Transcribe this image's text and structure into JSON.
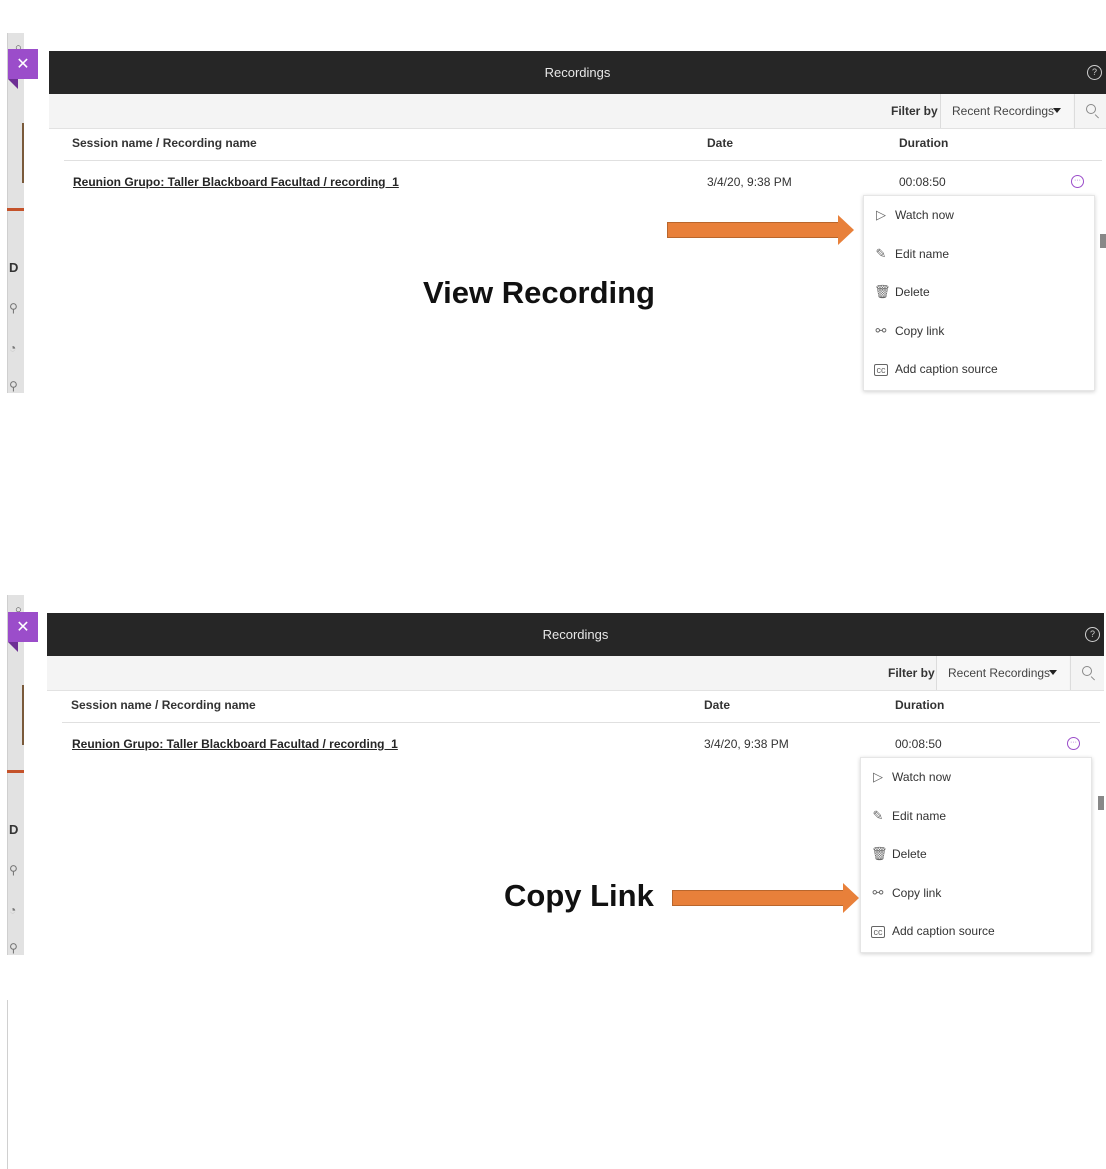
{
  "panels": [
    {
      "window_title": "Recordings",
      "filter_label": "Filter by",
      "filter_value": "Recent Recordings",
      "columns": [
        "Session name / Recording name",
        "Date",
        "Duration"
      ],
      "row": {
        "name": "Reunion Grupo: Taller Blackboard Facultad / recording_1",
        "date": "3/4/20, 9:38 PM",
        "duration": "00:08:50"
      },
      "menu": [
        {
          "label": "Watch now",
          "icon": "play-icon"
        },
        {
          "label": "Edit name",
          "icon": "pencil-icon"
        },
        {
          "label": "Delete",
          "icon": "trash-icon"
        },
        {
          "label": "Copy link",
          "icon": "link-icon"
        },
        {
          "label": "Add caption source",
          "icon": "cc-icon"
        }
      ],
      "callout": "View Recording",
      "highlighted_item": "Watch now"
    },
    {
      "window_title": "Recordings",
      "filter_label": "Filter by",
      "filter_value": "Recent Recordings",
      "columns": [
        "Session name / Recording name",
        "Date",
        "Duration"
      ],
      "row": {
        "name": "Reunion Grupo: Taller Blackboard Facultad / recording_1",
        "date": "3/4/20, 9:38 PM",
        "duration": "00:08:50"
      },
      "menu": [
        {
          "label": "Watch now",
          "icon": "play-icon"
        },
        {
          "label": "Edit name",
          "icon": "pencil-icon"
        },
        {
          "label": "Delete",
          "icon": "trash-icon"
        },
        {
          "label": "Copy link",
          "icon": "link-icon"
        },
        {
          "label": "Add caption source",
          "icon": "cc-icon"
        }
      ],
      "callout": "Copy Link",
      "highlighted_item": "Copy link"
    }
  ],
  "colors": {
    "accent": "#9b4dca",
    "titlebar": "#262626",
    "arrow": "#e8803a"
  }
}
